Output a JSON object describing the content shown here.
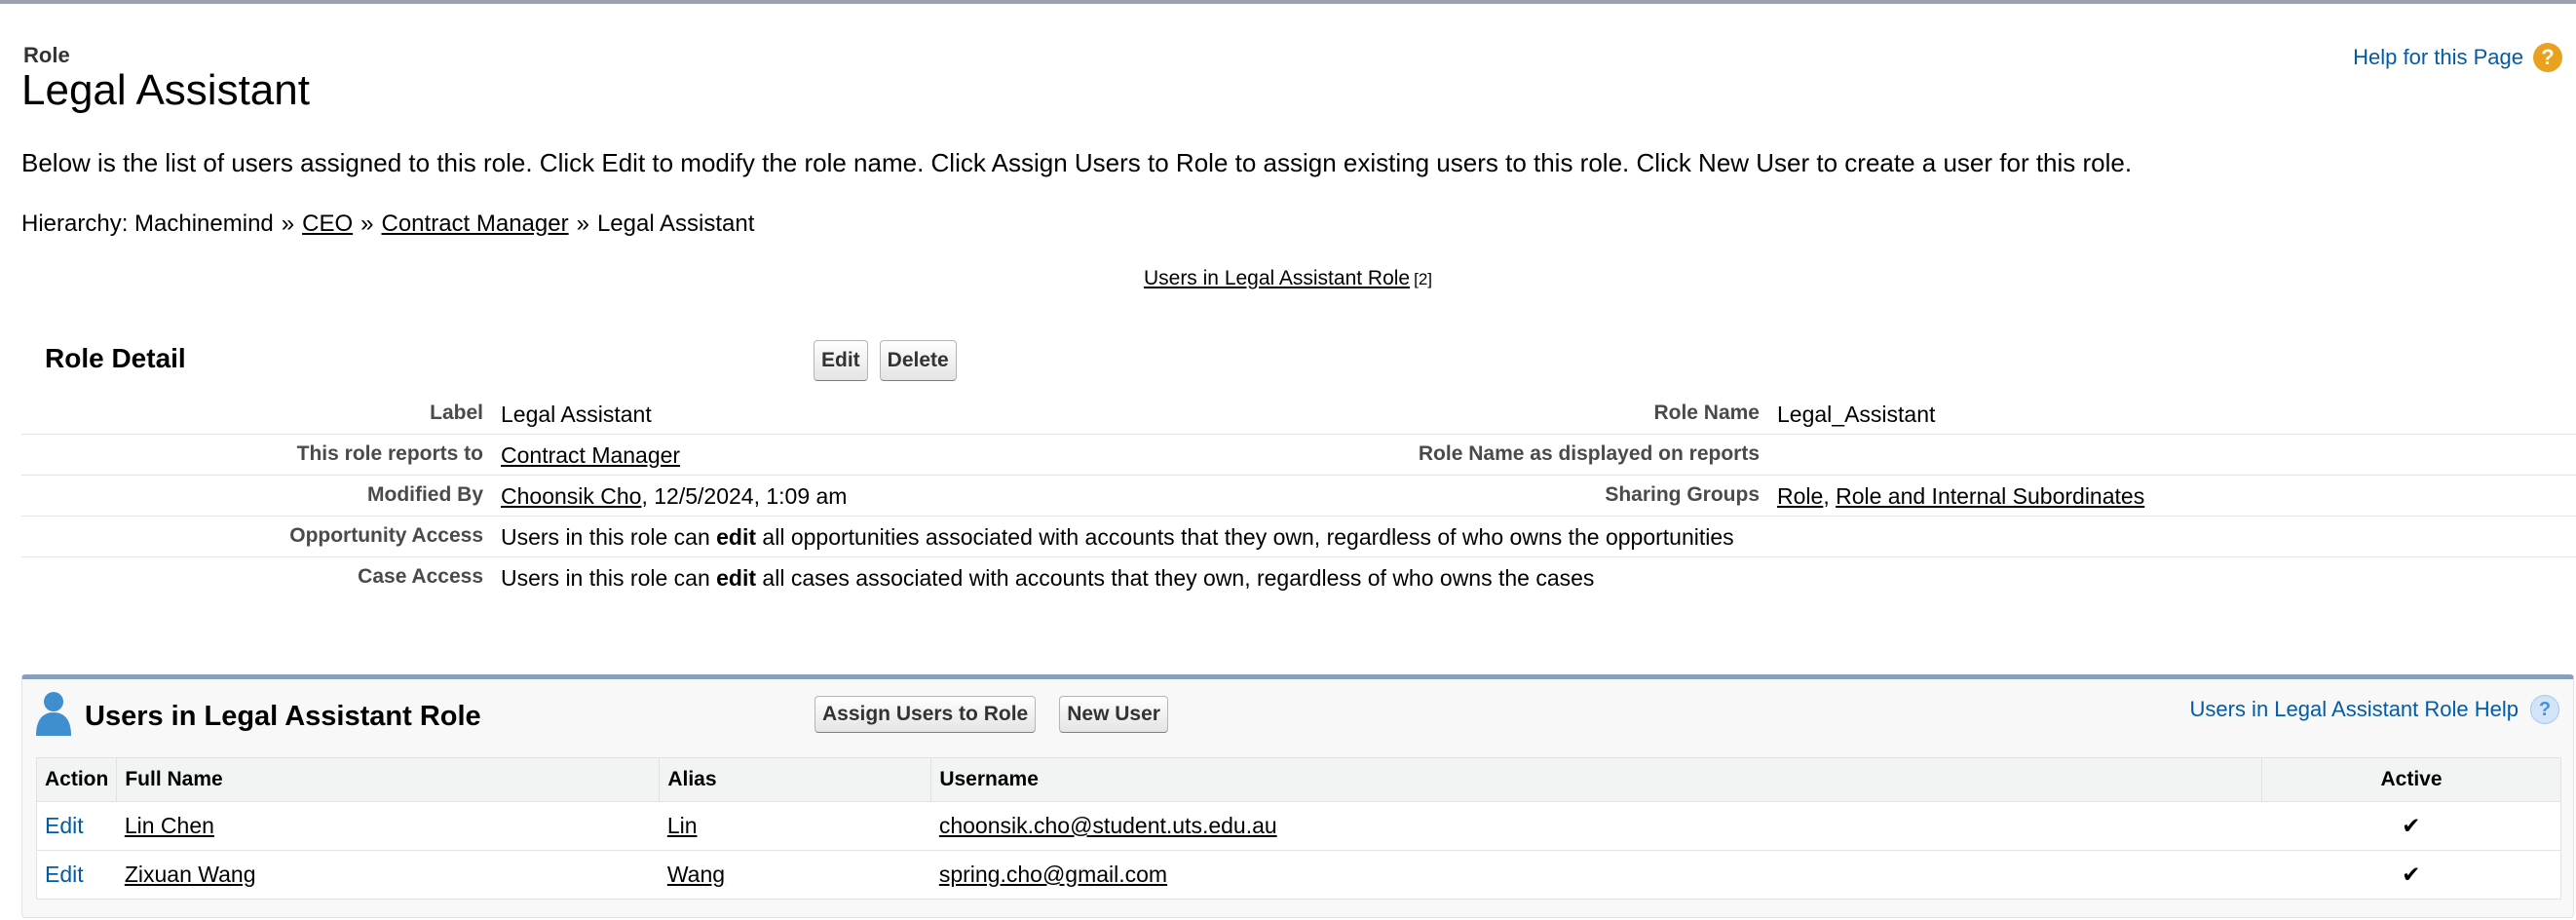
{
  "header": {
    "type": "Role",
    "title": "Legal Assistant",
    "help": "Help for this Page",
    "description": "Below is the list of users assigned to this role. Click Edit to modify the role name. Click Assign Users to Role to assign existing users to this role. Click New User to create a user for this role.",
    "hierarchy": {
      "prefix": "Hierarchy: Machinemind",
      "sep": "»",
      "ceo": "CEO",
      "contract_manager": "Contract Manager",
      "current": "Legal Assistant"
    },
    "related_link": "Users in Legal Assistant Role",
    "related_count": "[2]"
  },
  "role_detail": {
    "title": "Role Detail",
    "edit": "Edit",
    "delete": "Delete",
    "label_lbl": "Label",
    "label_val": "Legal Assistant",
    "role_name_lbl": "Role Name",
    "role_name_val": "Legal_Assistant",
    "reports_lbl": "This role reports to",
    "reports_val": "Contract Manager",
    "reports_name_lbl": "Role Name as displayed on reports",
    "modified_lbl": "Modified By",
    "modified_user": "Choonsik Cho",
    "modified_date": ", 12/5/2024, 1:09 am",
    "sharing_lbl": "Sharing Groups",
    "sharing_role": "Role",
    "sharing_comma": ",",
    "sharing_sub": "Role and Internal Subordinates",
    "opp_lbl": "Opportunity Access",
    "opp_pre": "Users in this role can",
    "opp_bold": "edit",
    "opp_post": "all opportunities associated with accounts that they own, regardless of who owns the opportunities",
    "case_lbl": "Case Access",
    "case_pre": "Users in this role can",
    "case_bold": "edit",
    "case_post": "all cases associated with accounts that they own, regardless of who owns the cases"
  },
  "users_list": {
    "title": "Users in Legal Assistant Role",
    "assign_btn": "Assign Users to Role",
    "new_btn": "New User",
    "help": "Users in Legal Assistant Role Help",
    "columns": {
      "action": "Action",
      "full_name": "Full Name",
      "alias": "Alias",
      "username": "Username",
      "active": "Active"
    },
    "rows": [
      {
        "action": "Edit",
        "full_name": "Lin Chen",
        "alias": "Lin",
        "username": "choonsik.cho@student.uts.edu.au",
        "active": "✔"
      },
      {
        "action": "Edit",
        "full_name": "Zixuan Wang",
        "alias": "Wang",
        "username": "spring.cho@gmail.com",
        "active": "✔"
      }
    ]
  },
  "colors": {
    "link_blue": "#015ba7",
    "help_orange": "#e8a21f",
    "list_border": "#8a9ebe"
  }
}
